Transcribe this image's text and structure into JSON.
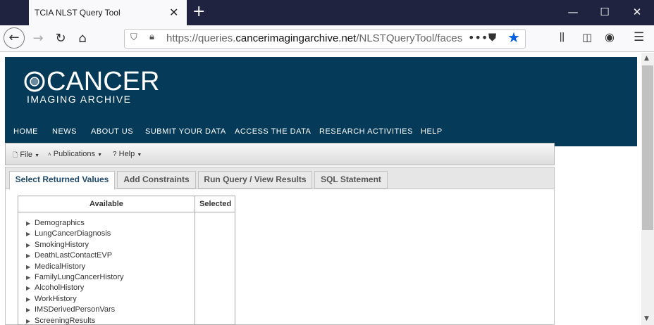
{
  "browser": {
    "tab_title": "TCIA NLST Query Tool",
    "tab_close": "✕",
    "new_tab": "+",
    "url_prefix": "https://queries.",
    "url_domain": "cancerimagingarchive.net",
    "url_path": "/NLSTQueryTool/faces/main.x"
  },
  "banner": {
    "logo_main": "CANCER",
    "logo_sub": "IMAGING ARCHIVE",
    "nav": [
      "HOME",
      "NEWS",
      "ABOUT US",
      "SUBMIT YOUR DATA",
      "ACCESS THE DATA",
      "RESEARCH ACTIVITIES",
      "HELP"
    ]
  },
  "menubar": {
    "file": "File",
    "publications": "Publications",
    "help": "Help"
  },
  "tabs": [
    "Select Returned Values",
    "Add Constraints",
    "Run Query / View Results",
    "SQL Statement"
  ],
  "table": {
    "header_available": "Available",
    "header_selected": "Selected",
    "items": [
      "Demographics",
      "LungCancerDiagnosis",
      "SmokingHistory",
      "DeathLastContactEVP",
      "MedicalHistory",
      "FamilyLungCancerHistory",
      "AlcoholHistory",
      "WorkHistory",
      "IMSDerivedPersonVars",
      "ScreeningResults"
    ]
  },
  "colors": {
    "banner": "#053a58",
    "titlebar": "#202340",
    "bookmark_star": "#0060df"
  }
}
